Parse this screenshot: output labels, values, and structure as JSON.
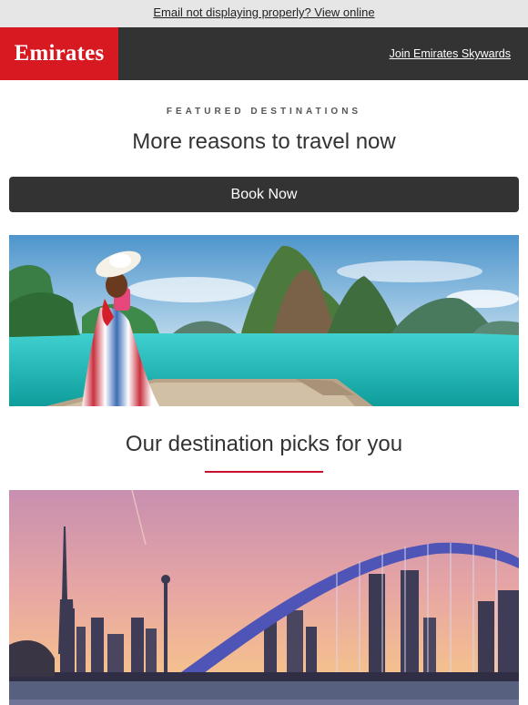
{
  "preheader": {
    "link_text": "Email not displaying properly? View online"
  },
  "header": {
    "logo_text": "Emirates",
    "skywards_link": "Join Emirates Skywards"
  },
  "featured": {
    "eyebrow": "FEATURED DESTINATIONS",
    "headline": "More reasons to travel now",
    "cta_label": "Book Now"
  },
  "picks": {
    "title": "Our destination picks for you"
  },
  "colors": {
    "brand_red": "#d71a21",
    "header_dark": "#333333",
    "accent_rule": "#c8102e"
  }
}
